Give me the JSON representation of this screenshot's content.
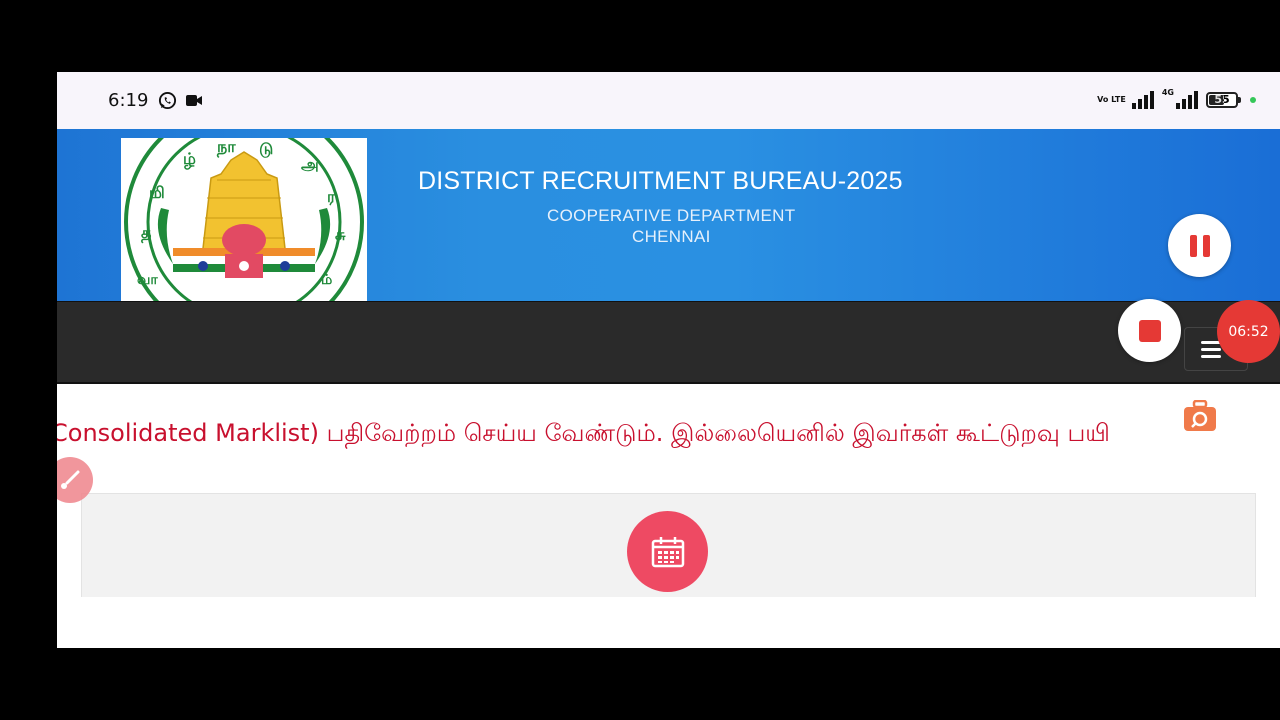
{
  "status_bar": {
    "time": "6:19",
    "network_volte": "Vo LTE",
    "network_4g": "4G",
    "battery": "55",
    "icons": [
      "whatsapp-icon",
      "video-camera-icon",
      "signal-icon",
      "signal-4g-icon",
      "battery-icon"
    ]
  },
  "header": {
    "title": "DISTRICT RECRUITMENT BUREAU-2025",
    "subtitle_line1": "COOPERATIVE DEPARTMENT",
    "subtitle_line2": "CHENNAI"
  },
  "nav": {
    "menu_icon": "hamburger-icon"
  },
  "marquee": {
    "text": "Consolidated Marklist) பதிவேற்றம் செய்ய வேண்டும். இல்லையெனில் இவர்கள் கூட்டுறவு பயி"
  },
  "recorder": {
    "timer": "06:52"
  },
  "colors": {
    "banner_blue": "#2a8fe0",
    "marquee_red": "#c8102e",
    "record_red": "#e53935",
    "calendar_pink": "#ee4a63"
  }
}
